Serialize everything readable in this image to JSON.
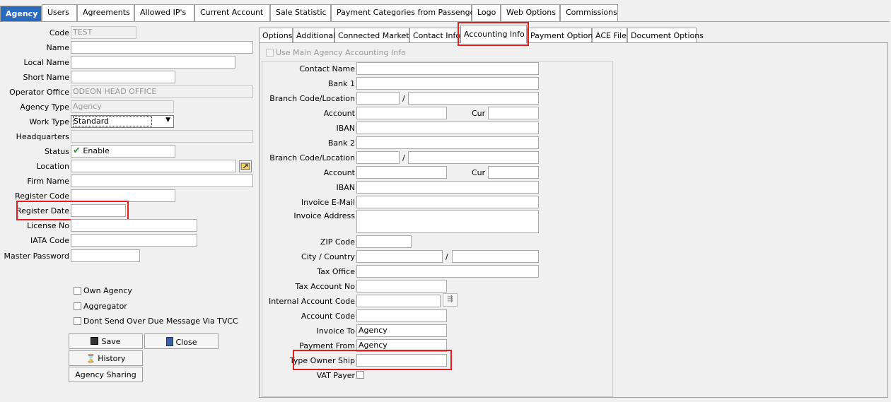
{
  "top_tabs": [
    "Agency",
    "Users",
    "Agreements",
    "Allowed IP's",
    "Current Account",
    "Sale Statistic",
    "Payment Categories from Passenger",
    "Logo",
    "Web Options",
    "Commissions"
  ],
  "left_form": {
    "code": {
      "label": "Code",
      "value": "TEST"
    },
    "name": {
      "label": "Name",
      "value": ""
    },
    "local_name": {
      "label": "Local Name",
      "value": ""
    },
    "short_name": {
      "label": "Short Name",
      "value": ""
    },
    "operator_office": {
      "label": "Operator Office",
      "value": "ODEON HEAD OFFICE"
    },
    "agency_type": {
      "label": "Agency Type",
      "value": "Agency"
    },
    "work_type": {
      "label": "Work Type",
      "value": "Standard"
    },
    "headquarters": {
      "label": "Headquarters",
      "value": ""
    },
    "status": {
      "label": "Status",
      "value": "Enable"
    },
    "location": {
      "label": "Location",
      "value": ""
    },
    "firm_name": {
      "label": "Firm Name",
      "value": ""
    },
    "register_code": {
      "label": "Register Code",
      "value": ""
    },
    "register_date": {
      "label": "Register Date",
      "value": ""
    },
    "license_no": {
      "label": "License No",
      "value": ""
    },
    "iata_code": {
      "label": "IATA Code",
      "value": ""
    },
    "master_password": {
      "label": "Master Password",
      "value": ""
    },
    "own_agency": "Own Agency",
    "aggregator": "Aggregator",
    "dont_send": "Dont Send Over Due Message Via TVCC"
  },
  "buttons": {
    "save": "Save",
    "close": "Close",
    "history": "History",
    "agency_sharing": "Agency Sharing"
  },
  "inner_tabs": [
    "Options",
    "Additional",
    "Connected Markets",
    "Contact Info",
    "Accounting  Info",
    "Payment Options",
    "ACE File",
    "Document Options"
  ],
  "accounting": {
    "use_main": "Use Main Agency Accounting Info",
    "contact_name": "Contact Name",
    "bank1": "Bank 1",
    "branch_code": "Branch Code/Location",
    "account": "Account",
    "cur": "Cur",
    "iban": "IBAN",
    "bank2": "Bank 2",
    "invoice_email": "Invoice E-Mail",
    "invoice_address": "Invoice Address",
    "zip_code": "ZIP Code",
    "city_country": "City / Country",
    "tax_office": "Tax Office",
    "tax_account_no": "Tax Account No",
    "internal_account_code": "Internal Account Code",
    "account_code": "Account Code",
    "invoice_to": {
      "label": "Invoice To",
      "value": "Agency"
    },
    "payment_from": {
      "label": "Payment From",
      "value": "Agency"
    },
    "type_owner_ship": "Type Owner Ship",
    "vat_payer": "VAT Payer",
    "slash": "/"
  },
  "colors": {
    "accent": "#2a6bbf",
    "highlight": "#e02020",
    "check": "#2e9a2e"
  }
}
